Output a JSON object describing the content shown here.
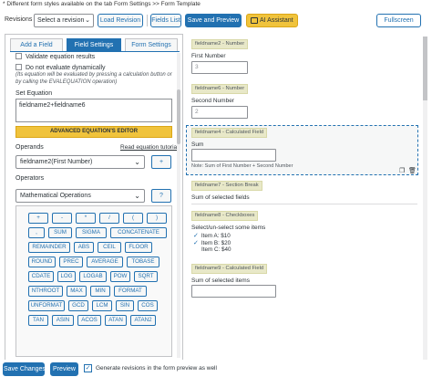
{
  "notice": "* Different form styles available on the tab Form Settings >> Form Template",
  "toolbar": {
    "revisions_label": "Revisions",
    "revision_select": "Select a revision",
    "load_revision": "Load Revision",
    "fields_list": "Fields List",
    "save_preview": "Save and Preview",
    "ai_assistant": "AI Assistant",
    "fullscreen": "Fullscreen"
  },
  "tabs": [
    "Add a Field",
    "Field Settings",
    "Form Settings"
  ],
  "field_settings": {
    "validate_label": "Validate equation results",
    "no_eval_label": "Do not evaluate dynamically",
    "no_eval_hint": "(Its equation will be evaluated by pressing a calculation button or by calling the EVALEQUATION operation)",
    "set_equation_label": "Set Equation",
    "equation_value": "fieldname2+fieldname6",
    "advanced_editor": "ADVANCED EQUATION'S EDITOR",
    "operands_label": "Operands",
    "read_tutorial": "Read equation tutorial",
    "operand_selected": "fieldname2(First Number)",
    "plus_btn": "+",
    "operators_label": "Operators",
    "operator_group": "Mathematical Operations",
    "help_btn": "?",
    "operators": [
      [
        "+",
        "-",
        "*",
        "/",
        "(",
        ")"
      ],
      [
        ",",
        "SUM",
        "SIGMA",
        "CONCATENATE"
      ],
      [
        "REMAINDER",
        "ABS",
        "CEIL",
        "FLOOR"
      ],
      [
        "ROUND",
        "PREC",
        "AVERAGE",
        "TOBASE"
      ],
      [
        "CDATE",
        "LOG",
        "LOGAB",
        "POW",
        "SQRT"
      ],
      [
        "NTHROOT",
        "MAX",
        "MIN",
        "FORMAT"
      ],
      [
        "UNFORMAT",
        "GCD",
        "LCM",
        "SIN",
        "COS"
      ],
      [
        "TAN",
        "ASIN",
        "ACOS",
        "ATAN",
        "ATAN2"
      ]
    ]
  },
  "preview": {
    "f2_tag": "fieldname2 - Number",
    "f2_label": "First Number",
    "f2_value": "3",
    "f6_tag": "fieldname6 - Number",
    "f6_label": "Second Number",
    "f6_value": "2",
    "f4_tag": "fieldname4 - Calculated Field",
    "f4_label": "Sum",
    "f4_note": "Note: Sum of First Number + Second Number",
    "f7_tag": "fieldname7 - Section Break",
    "f7_label": "Sum of selected fields",
    "f8_tag": "fieldname8 - Checkboxes",
    "f8_label": "Select/un-select some items",
    "f8_items": [
      "Item A: $10",
      "Item B: $20",
      "Item C: $40"
    ],
    "f9_tag": "fieldname9 - Calculated Field",
    "f9_label": "Sum of selected items"
  },
  "footer": {
    "save_changes": "Save Changes",
    "preview": "Preview",
    "generate_revisions": "Generate revisions in the form preview as well"
  }
}
